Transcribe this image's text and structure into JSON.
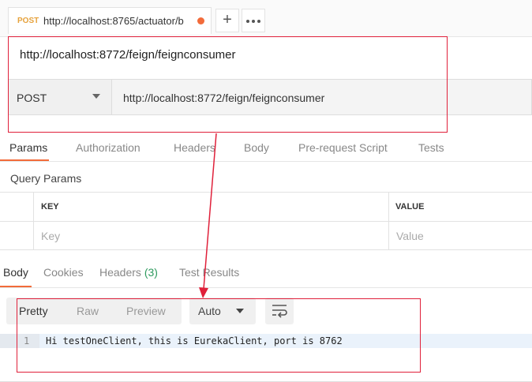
{
  "tab": {
    "method": "POST",
    "title": "http://localhost:8765/actuator/b",
    "add_icon": "plus-icon",
    "more_icon": "ellipsis-icon"
  },
  "request": {
    "name": "http://localhost:8772/feign/feignconsumer",
    "method": "POST",
    "url": "http://localhost:8772/feign/feignconsumer"
  },
  "request_tabs": [
    "Params",
    "Authorization",
    "Headers",
    "Body",
    "Pre-request Script",
    "Tests"
  ],
  "query_params": {
    "title": "Query Params",
    "headers": [
      "KEY",
      "VALUE"
    ],
    "placeholders": [
      "Key",
      "Value"
    ]
  },
  "response_tabs": {
    "body": "Body",
    "cookies": "Cookies",
    "headers": "Headers",
    "headers_count": "(3)",
    "test_results": "Test Results"
  },
  "response_toolbar": {
    "formats": [
      "Pretty",
      "Raw",
      "Preview"
    ],
    "language": "Auto",
    "wrap_icon": "wrap-lines-icon"
  },
  "response_body": {
    "line_number": "1",
    "text": "Hi testOneClient, this is EurekaClient, port is 8762"
  },
  "colors": {
    "accent": "#f26b3a",
    "annotation": "#e0203a",
    "method_tab": "#e6a23c",
    "count": "#2e9a5e"
  }
}
